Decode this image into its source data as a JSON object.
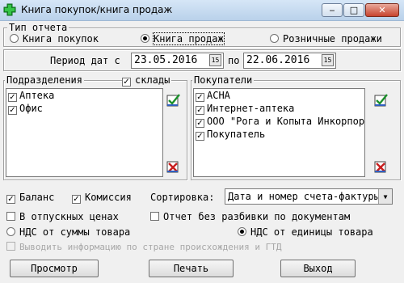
{
  "window": {
    "title": "Книга покупок/книга продаж",
    "icon": "green-plus-icon",
    "minimize": "‒",
    "maximize": "□",
    "close": "✕"
  },
  "report_type": {
    "legend": "Тип отчета",
    "options": [
      {
        "label": "Книга покупок",
        "selected": false
      },
      {
        "label": "Книга продаж",
        "selected": true
      },
      {
        "label": "Розничные продажи",
        "selected": false
      }
    ]
  },
  "period": {
    "label_from": "Период дат с",
    "from": "23.05.2016",
    "label_to": "по",
    "to": "22.06.2016",
    "calendar_icon": "15"
  },
  "departments": {
    "legend": "Подразделения",
    "warehouses_label": "склады",
    "warehouses_checked": true,
    "items": [
      {
        "label": "Аптека",
        "checked": true
      },
      {
        "label": "Офис",
        "checked": true
      }
    ]
  },
  "buyers": {
    "legend": "Покупатели",
    "items": [
      {
        "label": "АСНА",
        "checked": true
      },
      {
        "label": "Интернет-аптека",
        "checked": true
      },
      {
        "label": "ООО \"Рога и Копыта Инкорпорейтед\"",
        "checked": true
      },
      {
        "label": "Покупатель",
        "checked": true
      }
    ]
  },
  "options": {
    "balance_label": "Баланс",
    "balance_checked": true,
    "commission_label": "Комиссия",
    "commission_checked": true,
    "sort_label": "Сортировка:",
    "sort_value": "Дата и номер счета-фактуры",
    "vacation_prices_label": "В отпускных ценах",
    "vacation_prices_checked": false,
    "no_doc_split_label": "Отчет без разбивки по документам",
    "no_doc_split_checked": false,
    "vat_sum_label": "НДС от суммы товара",
    "vat_sum_selected": false,
    "vat_unit_label": "НДС от единицы товара",
    "vat_unit_selected": true,
    "country_gtd_label": "Выводить информацию по стране происхождения и ГТД",
    "country_gtd_checked": false
  },
  "buttons": {
    "preview": "Просмотр",
    "print": "Печать",
    "exit": "Выход"
  }
}
